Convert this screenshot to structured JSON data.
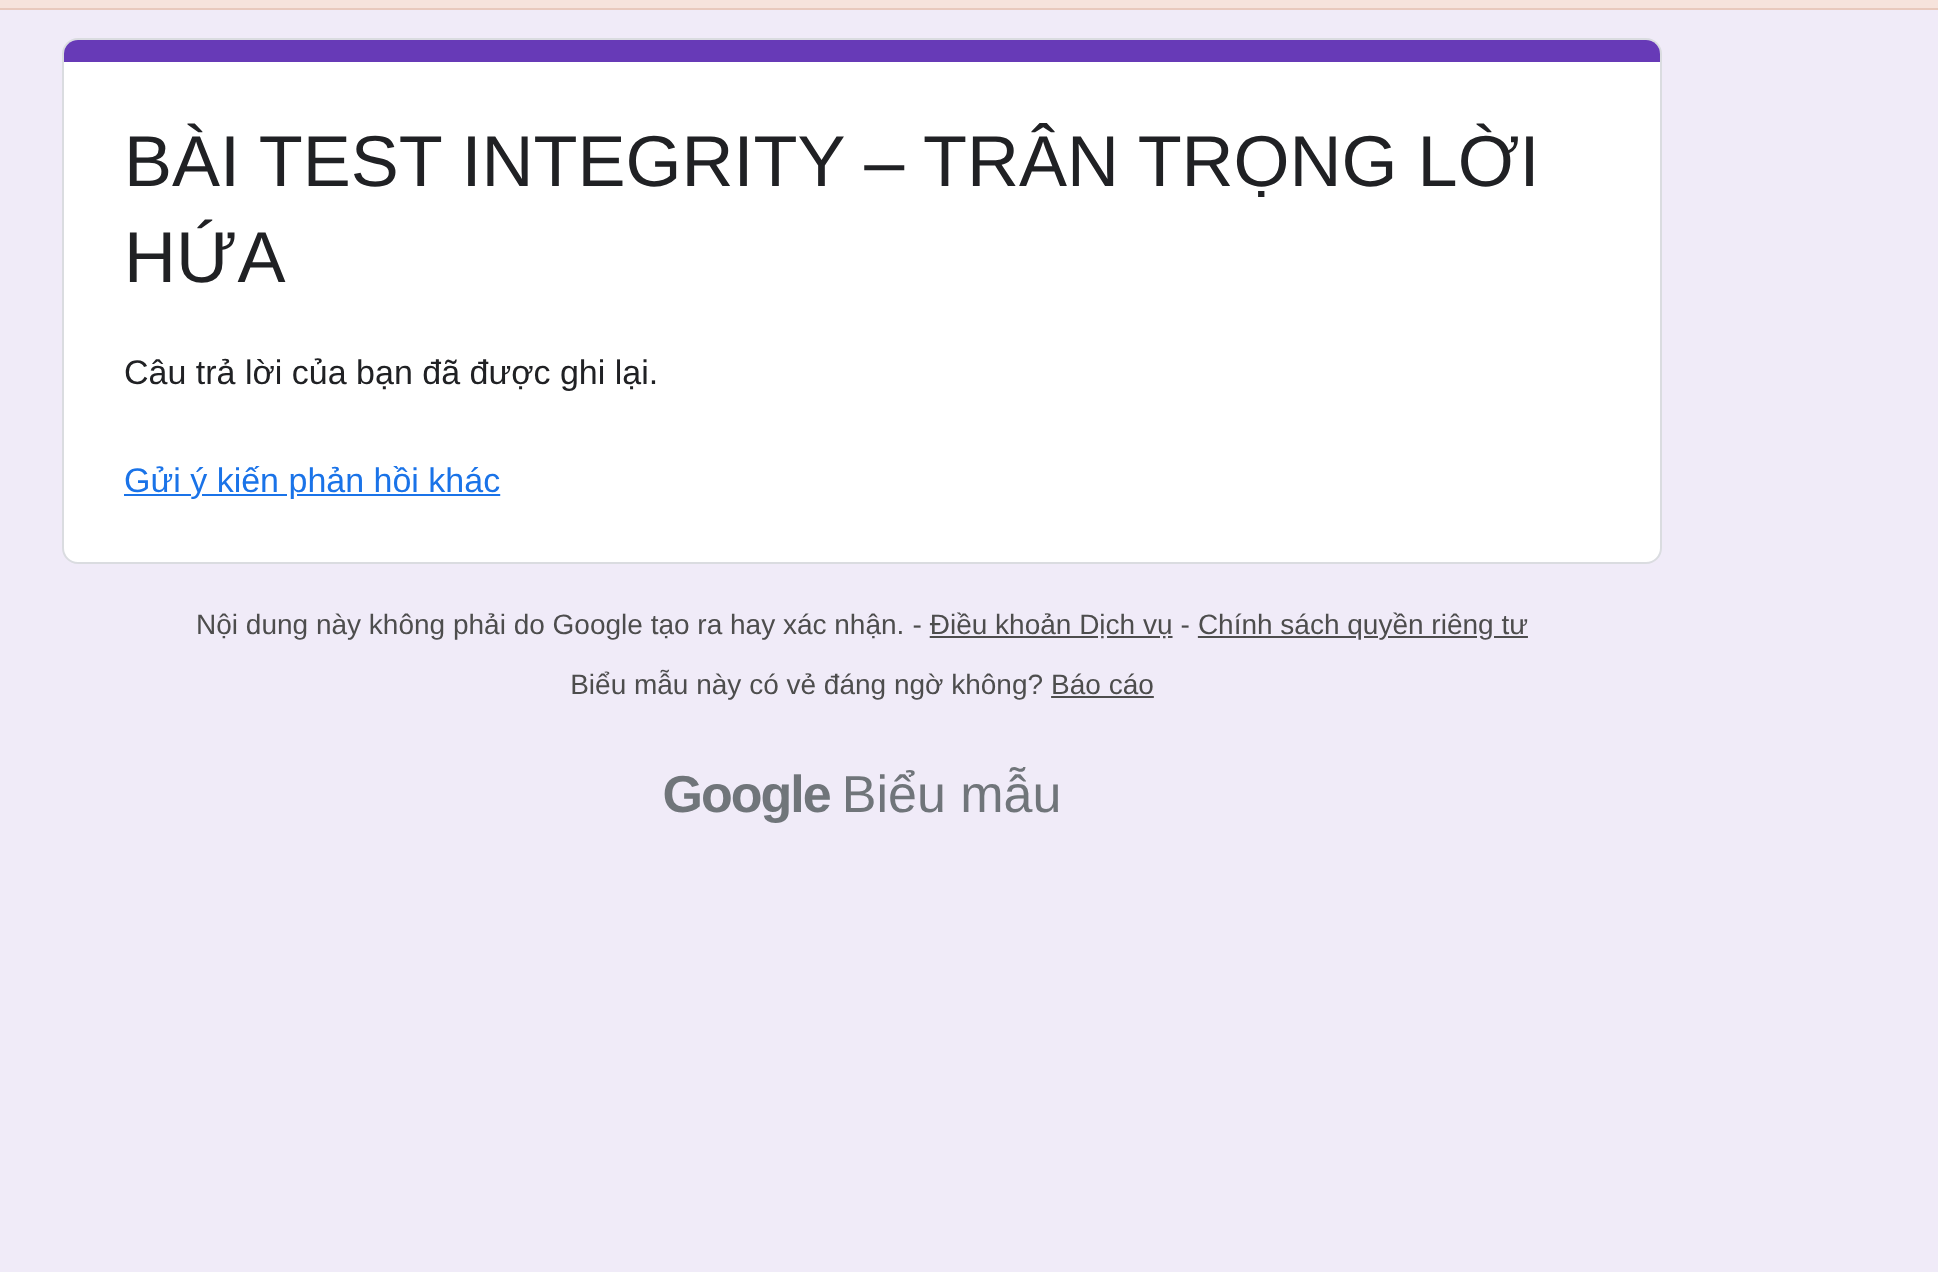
{
  "form": {
    "title": "BÀI TEST INTEGRITY – TRÂN TRỌNG LỜI HỨA",
    "message": "Câu trả lời của bạn đã được ghi lại.",
    "link": "Gửi ý kiến phản hồi khác"
  },
  "footer": [
    {
      "parts": [
        {
          "kind": "text",
          "text": "Nội dung này không phải do Google tạo ra hay xác nhận."
        },
        {
          "kind": "text",
          "text": "-"
        },
        {
          "kind": "link",
          "text": "Điều khoản Dịch vụ"
        },
        {
          "kind": "text",
          "text": "-"
        },
        {
          "kind": "link",
          "text": "Chính sách quyền riêng tư"
        }
      ]
    },
    {
      "parts": [
        {
          "kind": "text",
          "text": "Biểu mẫu này có vẻ đáng ngờ không?"
        },
        {
          "kind": "link",
          "text": "Báo cáo"
        }
      ]
    }
  ],
  "brand": {
    "name": "Google",
    "product": "Biểu mẫu"
  }
}
